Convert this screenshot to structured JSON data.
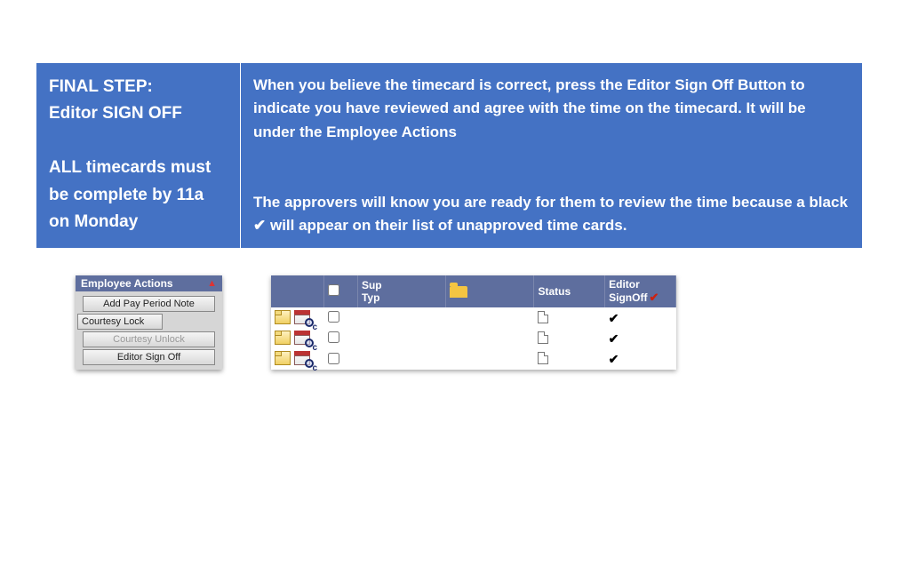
{
  "info": {
    "left_line1": "FINAL STEP:",
    "left_line2": "Editor SIGN OFF",
    "left_para2": "ALL timecards must be complete by 11a on Monday",
    "right_para1": "When you believe the timecard is correct, press the Editor Sign Off Button to indicate you have reviewed and agree with the time on the timecard.  It will be under the Employee Actions",
    "right_para2a": "The approvers will know you are ready for them to review the time because a black ",
    "right_para2b": " will appear on their list of unapproved time cards.",
    "checkmark": "✔"
  },
  "emp": {
    "header": "Employee Actions",
    "btn_add": "Add Pay Period Note",
    "btn_lock": "Courtesy Lock",
    "btn_unlock": "Courtesy Unlock",
    "btn_signoff": "Editor Sign Off"
  },
  "status": {
    "hdr_suptyp_l1": "Sup",
    "hdr_suptyp_l2": "Typ",
    "hdr_status": "Status",
    "hdr_editor_l1": "Editor",
    "hdr_editor_l2": "SignOff",
    "rows": [
      {
        "signed": "✔"
      },
      {
        "signed": "✔"
      },
      {
        "signed": "✔"
      }
    ]
  }
}
